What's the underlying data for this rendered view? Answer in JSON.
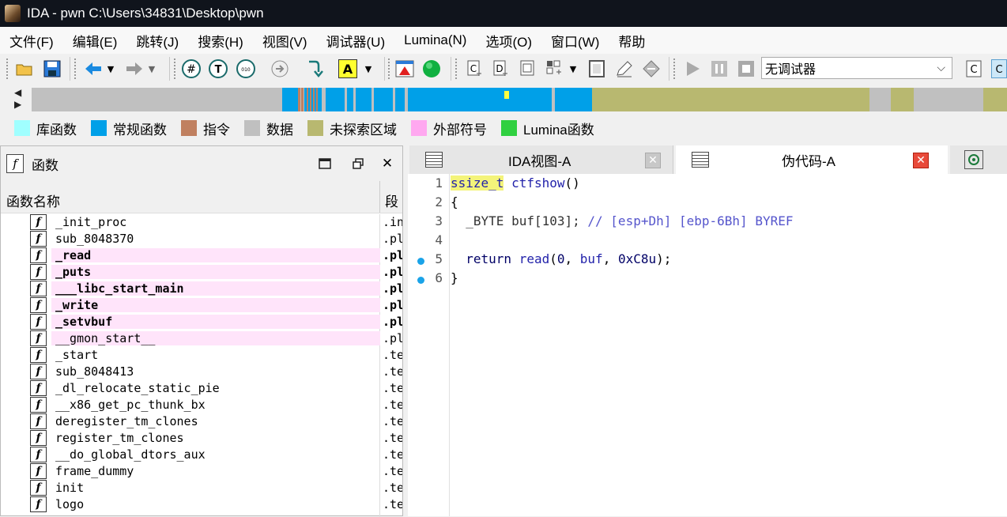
{
  "title": "IDA - pwn C:\\Users\\34831\\Desktop\\pwn",
  "menu": [
    "文件(F)",
    "编辑(E)",
    "跳转(J)",
    "搜索(H)",
    "视图(V)",
    "调试器(U)",
    "Lumina(N)",
    "选项(O)",
    "窗口(W)",
    "帮助"
  ],
  "toolbar": {
    "debugger_select": "无调试器"
  },
  "legend": [
    {
      "label": "库函数",
      "color": "#a0ffff"
    },
    {
      "label": "常规函数",
      "color": "#00a0e8"
    },
    {
      "label": "指令",
      "color": "#c08060"
    },
    {
      "label": "数据",
      "color": "#c0c0c0"
    },
    {
      "label": "未探索区域",
      "color": "#b8b870"
    },
    {
      "label": "外部符号",
      "color": "#ffa8f0"
    },
    {
      "label": "Lumina函数",
      "color": "#30d040"
    }
  ],
  "functions_pane": {
    "title": "函数",
    "col_name": "函数名称",
    "col_segment": "段",
    "rows": [
      {
        "name": "_init_proc",
        "segment": ".in",
        "bold": false,
        "highlight": false
      },
      {
        "name": "sub_8048370",
        "segment": ".pl",
        "bold": false,
        "highlight": false
      },
      {
        "name": "_read",
        "segment": ".pl",
        "bold": true,
        "highlight": true
      },
      {
        "name": "_puts",
        "segment": ".pl",
        "bold": true,
        "highlight": true
      },
      {
        "name": "___libc_start_main",
        "segment": ".pl",
        "bold": true,
        "highlight": true
      },
      {
        "name": "_write",
        "segment": ".pl",
        "bold": true,
        "highlight": true
      },
      {
        "name": "_setvbuf",
        "segment": ".pl",
        "bold": true,
        "highlight": true
      },
      {
        "name": "__gmon_start__",
        "segment": ".pl",
        "bold": false,
        "highlight": true
      },
      {
        "name": "_start",
        "segment": ".te",
        "bold": false,
        "highlight": false
      },
      {
        "name": "sub_8048413",
        "segment": ".te",
        "bold": false,
        "highlight": false
      },
      {
        "name": "_dl_relocate_static_pie",
        "segment": ".te",
        "bold": false,
        "highlight": false
      },
      {
        "name": "__x86_get_pc_thunk_bx",
        "segment": ".te",
        "bold": false,
        "highlight": false
      },
      {
        "name": "deregister_tm_clones",
        "segment": ".te",
        "bold": false,
        "highlight": false
      },
      {
        "name": "register_tm_clones",
        "segment": ".te",
        "bold": false,
        "highlight": false
      },
      {
        "name": "__do_global_dtors_aux",
        "segment": ".te",
        "bold": false,
        "highlight": false
      },
      {
        "name": "frame_dummy",
        "segment": ".te",
        "bold": false,
        "highlight": false
      },
      {
        "name": "init",
        "segment": ".te",
        "bold": false,
        "highlight": false
      },
      {
        "name": "logo",
        "segment": ".te",
        "bold": false,
        "highlight": false
      }
    ]
  },
  "tabs": [
    {
      "label": "IDA视图-A",
      "active": false
    },
    {
      "label": "伪代码-A",
      "active": true
    }
  ],
  "code": {
    "line_numbers": [
      "1",
      "2",
      "3",
      "4",
      "5",
      "6"
    ],
    "l1_type": "ssize_t",
    "l1_name": "ctfshow",
    "l1_rest": "()",
    "l2": "{",
    "l3_decl": "  _BYTE buf[103];",
    "l3_comment": " // [esp+Dh] [ebp-6Bh] BYREF",
    "l5_ret": "  return ",
    "l5_fn": "read",
    "l5_open": "(",
    "l5_zero": "0",
    "l5_comma1": ", ",
    "l5_buf": "buf",
    "l5_comma2": ", ",
    "l5_num": "0xC8u",
    "l5_close": ");",
    "l6": "}"
  }
}
